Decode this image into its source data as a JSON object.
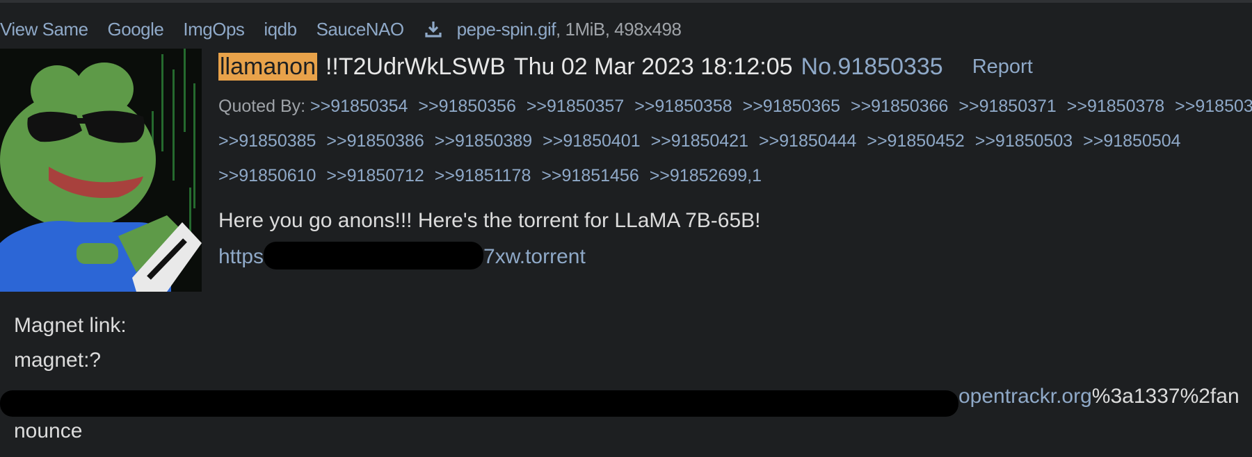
{
  "file_bar": {
    "links": [
      "View Same",
      "Google",
      "ImgOps",
      "iqdb",
      "SauceNAO"
    ],
    "filename": "pepe-spin.gif",
    "meta": ", 1MiB, 498x498",
    "download_icon": "download-icon"
  },
  "post": {
    "name": "llamanon",
    "tripcode": "!!T2UdrWkLSWB",
    "date": "Thu 02 Mar 2023 18:12:05",
    "number": "No.91850335",
    "report": "Report",
    "quoted_by_label": "Quoted By:",
    "quoted_lines": [
      [
        ">>91850354",
        ">>91850356",
        ">>91850357",
        ">>91850358",
        ">>91850365",
        ">>91850366",
        ">>91850371",
        ">>91850378",
        ">>918503"
      ],
      [
        ">>91850385",
        ">>91850386",
        ">>91850389",
        ">>91850401",
        ">>91850421",
        ">>91850444",
        ">>91850452",
        ">>91850503",
        ">>91850504"
      ],
      [
        ">>91850610",
        ">>91850712",
        ">>91851178",
        ">>91851456",
        ">>91852699,1"
      ]
    ],
    "message_line": "Here you go anons!!! Here's the torrent for LLaMA 7B-65B!",
    "torrent_prefix": "https",
    "torrent_suffix": "7xw.torrent",
    "magnet_label": "Magnet link:",
    "magnet_start": "magnet:?",
    "magnet_tail_link": "opentrackr.org",
    "magnet_tail_text": "%3a1337%2fan",
    "magnet_end": "nounce"
  },
  "colors": {
    "background": "#1d1f21",
    "link": "#8fa9c8",
    "name_highlight": "#e8a24a",
    "text": "#dcdcdc"
  }
}
